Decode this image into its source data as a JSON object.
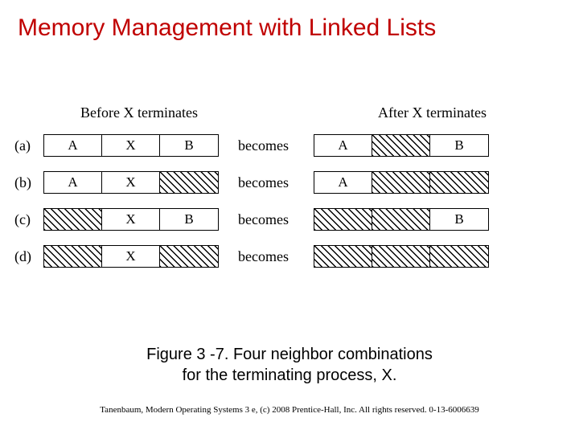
{
  "title": "Memory Management with Linked Lists",
  "header_before": "Before X terminates",
  "header_after": "After X terminates",
  "becomes": "becomes",
  "rows": [
    {
      "label": "(a)",
      "before": [
        {
          "text": "A",
          "hatch": false
        },
        {
          "text": "X",
          "hatch": false
        },
        {
          "text": "B",
          "hatch": false
        }
      ],
      "after": [
        {
          "text": "A",
          "hatch": false
        },
        {
          "text": "",
          "hatch": true
        },
        {
          "text": "B",
          "hatch": false
        }
      ]
    },
    {
      "label": "(b)",
      "before": [
        {
          "text": "A",
          "hatch": false
        },
        {
          "text": "X",
          "hatch": false
        },
        {
          "text": "",
          "hatch": true
        }
      ],
      "after": [
        {
          "text": "A",
          "hatch": false
        },
        {
          "text": "",
          "hatch": true
        },
        {
          "text": "",
          "hatch": true
        }
      ]
    },
    {
      "label": "(c)",
      "before": [
        {
          "text": "",
          "hatch": true
        },
        {
          "text": "X",
          "hatch": false
        },
        {
          "text": "B",
          "hatch": false
        }
      ],
      "after": [
        {
          "text": "",
          "hatch": true
        },
        {
          "text": "",
          "hatch": true
        },
        {
          "text": "B",
          "hatch": false
        }
      ]
    },
    {
      "label": "(d)",
      "before": [
        {
          "text": "",
          "hatch": true
        },
        {
          "text": "X",
          "hatch": false
        },
        {
          "text": "",
          "hatch": true
        }
      ],
      "after": [
        {
          "text": "",
          "hatch": true
        },
        {
          "text": "",
          "hatch": true
        },
        {
          "text": "",
          "hatch": true
        }
      ]
    }
  ],
  "caption_line1": "Figure 3 -7. Four neighbor combinations",
  "caption_line2": "for the terminating process, X.",
  "footer": "Tanenbaum, Modern Operating Systems 3 e, (c) 2008 Prentice-Hall, Inc. All rights reserved. 0-13-6006639"
}
